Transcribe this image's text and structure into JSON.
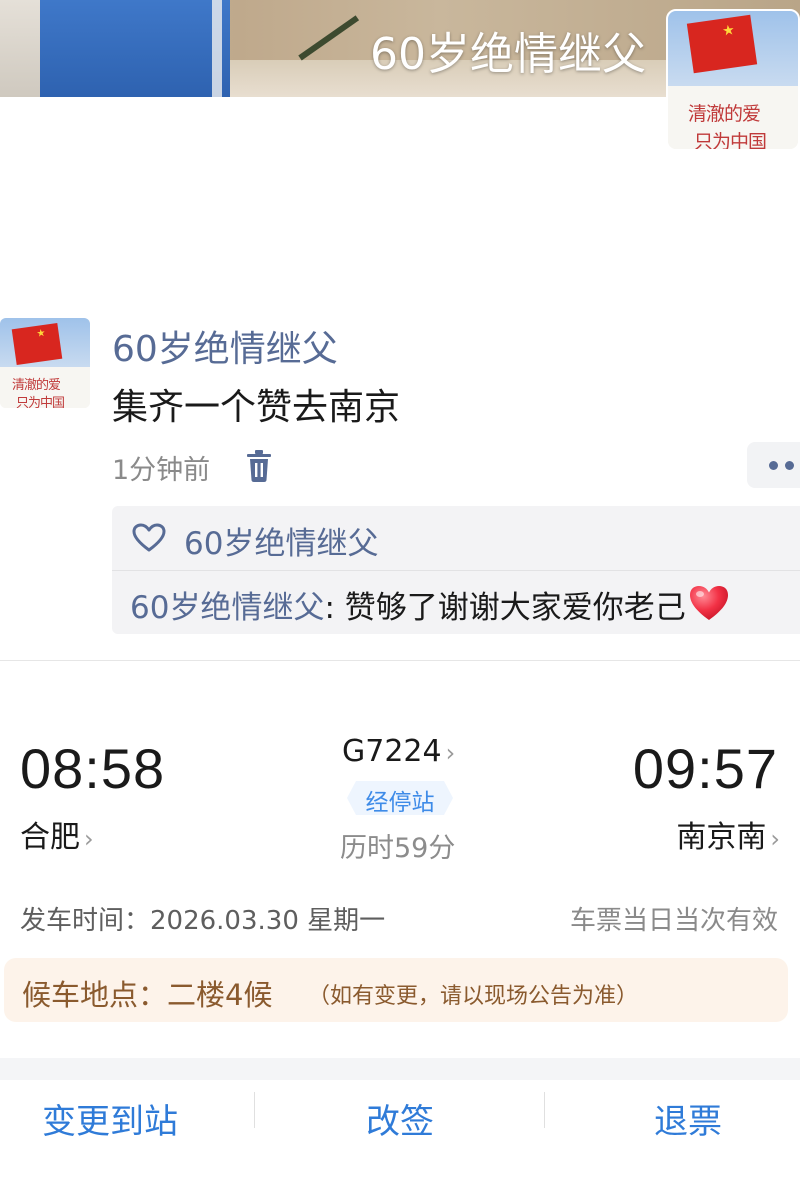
{
  "cover": {
    "title": "60岁绝情继父"
  },
  "post": {
    "author": "60岁绝情继父",
    "text": "集齐一个赞去南京",
    "time": "1分钟前",
    "likes": {
      "names": "60岁绝情继父"
    },
    "comment": {
      "author": "60岁绝情继父",
      "separator": ": ",
      "text": "赞够了谢谢大家爱你老己",
      "emoji": "red-heart-emoji"
    }
  },
  "ticket": {
    "departure": {
      "time": "08:58",
      "station": "合肥"
    },
    "arrival": {
      "time": "09:57",
      "station": "南京南"
    },
    "train_no": "G7224",
    "stops_label": "经停站",
    "duration": "历时59分",
    "departure_date": "发车时间：2026.03.30 星期一",
    "validity": "车票当日当次有效",
    "waiting": {
      "label": "候车地点：二楼4候",
      "note": "（如有变更，请以现场公告为准）"
    }
  },
  "actions": {
    "change_station": "变更到站",
    "rebook": "改签",
    "refund": "退票"
  },
  "colors": {
    "wechat_name_blue": "#576b95",
    "action_blue": "#2f7bd8",
    "stops_blue": "#3e8be8",
    "waiting_bg": "#fdf3ea",
    "waiting_text": "#8a5a2e"
  }
}
